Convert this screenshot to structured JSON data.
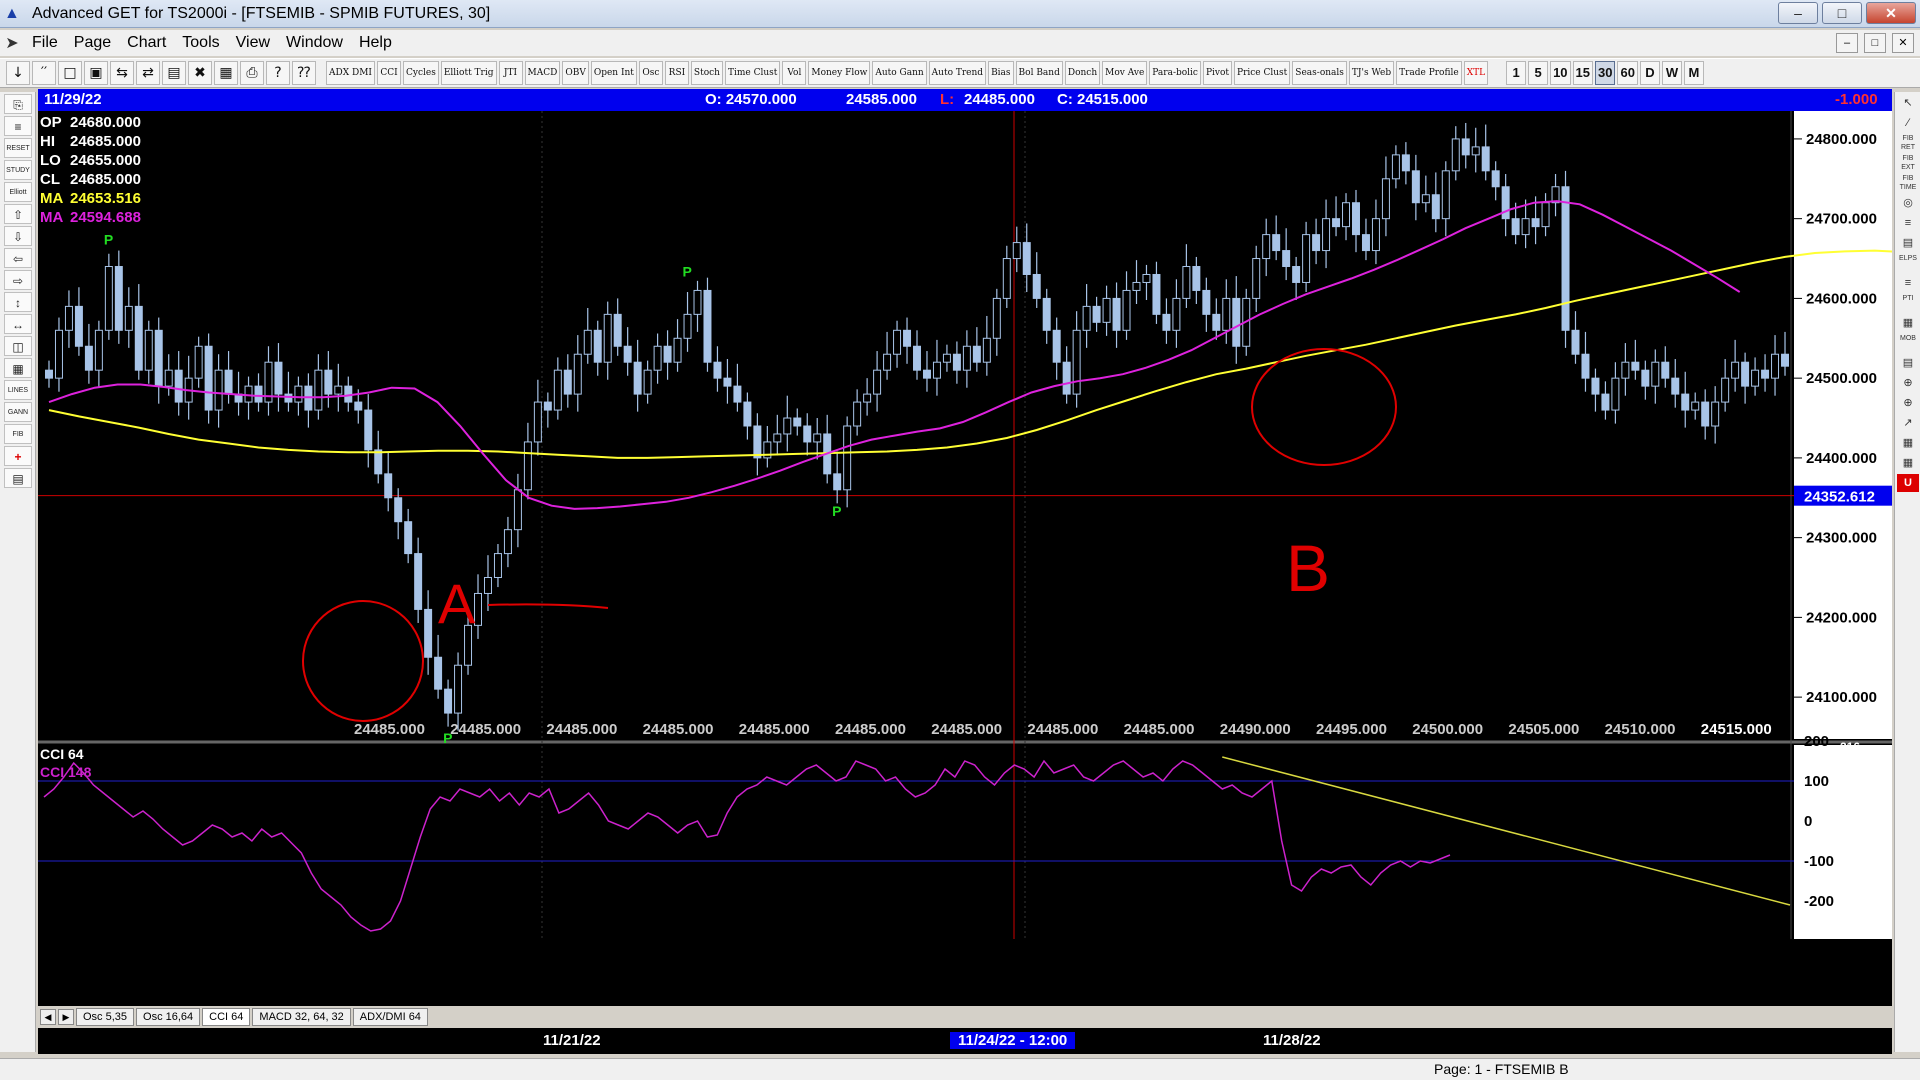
{
  "window": {
    "title": "Advanced GET for TS2000i - [FTSEMIB - SPMIB FUTURES, 30]",
    "minimize": "–",
    "maximize": "□",
    "close": "✕"
  },
  "menu": [
    "File",
    "Page",
    "Chart",
    "Tools",
    "View",
    "Window",
    "Help"
  ],
  "mdi_buttons": [
    "–",
    "□",
    "✕"
  ],
  "toolbar": {
    "file_icons": [
      "↓",
      "′′",
      "□",
      "▣",
      "⇆",
      "⇄",
      "▤",
      "✖",
      "▦",
      "⎙",
      "?",
      "⁇"
    ],
    "study_buttons": [
      "ADX DMI",
      "CCI",
      "Cycles",
      "Elliott Trig",
      "JTI",
      "MACD",
      "OBV",
      "Open Int",
      "Osc",
      "RSI",
      "Stoch",
      "Time Clust",
      "Vol",
      "Money Flow",
      "Auto Gann",
      "Auto Trend",
      "Bias",
      "Bol Band",
      "Donch",
      "Mov Ave",
      "Para-bolic",
      "Pivot",
      "Price Clust",
      "Seas-onals",
      "TJ's Web",
      "Trade Profile",
      "XTL"
    ],
    "periods": [
      "1",
      "5",
      "10",
      "15",
      "30",
      "60",
      "D",
      "W",
      "M"
    ],
    "active_period": "30"
  },
  "left_tools": [
    "⎘",
    "≡",
    "RESET",
    "STUDY",
    "Elliott",
    "⇧",
    "⇩",
    "⇦",
    "⇨",
    "↕",
    "↔",
    "◫",
    "▦",
    "LINES",
    "GANN",
    "FIB",
    "+",
    "▤"
  ],
  "right_tools": [
    "↖",
    "∕",
    "FIB RET",
    "FIB EXT",
    "FIB TIME",
    "◎",
    "≡",
    "▤",
    "ELPS",
    "≡",
    "PTI",
    "▦",
    "MOB",
    "▤",
    "⊕",
    "⊕",
    "↗",
    "▦",
    "▦",
    "U"
  ],
  "info_bar": {
    "date": "11/29/22",
    "open": "O: 24570.000",
    "high": "24585.000",
    "low_label": "L:",
    "low": "24485.000",
    "close": "C: 24515.000",
    "change": "-1.000"
  },
  "readout": {
    "op": {
      "label": "OP",
      "value": "24680.000"
    },
    "hi": {
      "label": "HI",
      "value": "24685.000"
    },
    "lo": {
      "label": "LO",
      "value": "24655.000"
    },
    "cl": {
      "label": "CL",
      "value": "24685.000"
    },
    "ma1": {
      "label": "MA",
      "value": "24653.516"
    },
    "ma2": {
      "label": "MA",
      "value": "24594.688"
    }
  },
  "cursor_price": "24352.612",
  "annotations": {
    "a": "A",
    "b": "B",
    "pivot": "P"
  },
  "colors": {
    "up": "#a8c4e8",
    "ma_fast": "#ffff33",
    "ma_slow": "#dd22dd",
    "cci": "#cc22cc",
    "trendline": "#d8d840",
    "marker": "#e00000",
    "pivot": "#22dd22",
    "info_bg": "#0000ee"
  },
  "chart_data": [
    {
      "type": "candlestick",
      "title": "FTSEMIB - SPMIB FUTURES, 30",
      "ylim": [
        24050,
        24830
      ],
      "y_ticks": [
        "24800.000",
        "24700.000",
        "24600.000",
        "24500.000",
        "24400.000",
        "24300.000",
        "24200.000",
        "24100.000"
      ],
      "x_price_labels": [
        "24485.000",
        "24485.000",
        "24485.000",
        "24485.000",
        "24485.000",
        "24485.000",
        "24485.000",
        "24485.000",
        "24485.000",
        "24490.000",
        "24495.000",
        "24500.000",
        "24505.000",
        "24510.000",
        "24515.000"
      ],
      "closes": [
        24500,
        24560,
        24590,
        24540,
        24510,
        24560,
        24640,
        24560,
        24590,
        24510,
        24560,
        24490,
        24510,
        24470,
        24500,
        24540,
        24460,
        24510,
        24480,
        24470,
        24490,
        24470,
        24520,
        24480,
        24470,
        24490,
        24460,
        24510,
        24480,
        24490,
        24470,
        24460,
        24410,
        24380,
        24350,
        24320,
        24280,
        24210,
        24150,
        24110,
        24080,
        24140,
        24190,
        24230,
        24250,
        24280,
        24310,
        24360,
        24420,
        24470,
        24460,
        24510,
        24480,
        24530,
        24560,
        24520,
        24580,
        24540,
        24520,
        24480,
        24510,
        24540,
        24520,
        24550,
        24580,
        24610,
        24520,
        24500,
        24490,
        24470,
        24440,
        24400,
        24420,
        24430,
        24450,
        24440,
        24420,
        24430,
        24380,
        24360,
        24440,
        24470,
        24480,
        24510,
        24530,
        24560,
        24540,
        24510,
        24500,
        24520,
        24530,
        24510,
        24540,
        24520,
        24550,
        24600,
        24650,
        24670,
        24630,
        24600,
        24560,
        24520,
        24480,
        24560,
        24590,
        24570,
        24600,
        24560,
        24610,
        24620,
        24630,
        24580,
        24560,
        24600,
        24640,
        24610,
        24580,
        24560,
        24600,
        24540,
        24600,
        24650,
        24680,
        24660,
        24640,
        24620,
        24680,
        24660,
        24700,
        24690,
        24720,
        24680,
        24660,
        24700,
        24750,
        24780,
        24760,
        24720,
        24730,
        24700,
        24760,
        24800,
        24780,
        24790,
        24760,
        24740,
        24700,
        24680,
        24700,
        24690,
        24720,
        24740,
        24560,
        24530,
        24500,
        24480,
        24460,
        24500,
        24520,
        24510,
        24490,
        24520,
        24500,
        24480,
        24460,
        24470,
        24440,
        24470,
        24500,
        24520,
        24490,
        24510,
        24500,
        24530,
        24515
      ],
      "ma_fast": [
        24460,
        24452,
        24445,
        24438,
        24430,
        24423,
        24418,
        24413,
        24410,
        24408,
        24407,
        24407,
        24408,
        24409,
        24409,
        24408,
        24406,
        24404,
        24402,
        24400,
        24400,
        24401,
        24402,
        24403,
        24404,
        24405,
        24406,
        24407,
        24408,
        24410,
        24413,
        24418,
        24425,
        24435,
        24447,
        24460,
        24472,
        24484,
        24495,
        24505,
        24512,
        24520,
        24528,
        24535,
        24542,
        24550,
        24558,
        24566,
        24573,
        24580,
        24588,
        24597,
        24605,
        24613,
        24621,
        24629,
        24637,
        24645,
        24652,
        24657,
        24659,
        24660,
        24658,
        24656,
        24652,
        24648,
        24640,
        24633
      ],
      "ma_fast_start": 0,
      "ma_fast_step": 3,
      "ma_slow": [
        24470,
        24480,
        24488,
        24492,
        24492,
        24489,
        24485,
        24482,
        24480,
        24478,
        24477,
        24476,
        24476,
        24478,
        24482,
        24488,
        24487,
        24470,
        24440,
        24405,
        24372,
        24350,
        24340,
        24336,
        24337,
        24339,
        24342,
        24345,
        24350,
        24357,
        24365,
        24374,
        24384,
        24395,
        24405,
        24415,
        24423,
        24428,
        24433,
        24437,
        24445,
        24457,
        24470,
        24482,
        24490,
        24496,
        24500,
        24505,
        24513,
        24523,
        24535,
        24550,
        24565,
        24580,
        24593,
        24605,
        24615,
        24625,
        24636,
        24648,
        24661,
        24674,
        24688,
        24700,
        24712,
        24720,
        24722,
        24718,
        24705,
        24690,
        24675,
        24660,
        24643,
        24626,
        24608
      ],
      "ma_slow_start": 0,
      "ma_slow_step": 2.29,
      "pivots": [
        {
          "bar": 6,
          "type": "high",
          "price": 24650
        },
        {
          "bar": 40,
          "type": "low",
          "price": 24070
        },
        {
          "bar": 64,
          "type": "high",
          "price": 24610
        },
        {
          "bar": 79,
          "type": "low",
          "price": 24355
        }
      ],
      "cursor_price": 24352.612
    },
    {
      "type": "line",
      "title": "CCI 64",
      "legend": "CCI 148",
      "ylim": [
        -280,
        210
      ],
      "y_ticks": [
        "200",
        "100",
        "0",
        "-100",
        "-200"
      ],
      "top_value": "216",
      "values": [
        60,
        80,
        110,
        145,
        120,
        90,
        70,
        50,
        30,
        10,
        25,
        5,
        -20,
        -40,
        -60,
        -50,
        -30,
        -10,
        -20,
        -40,
        -30,
        -50,
        -20,
        -40,
        -30,
        -55,
        -80,
        -130,
        -170,
        -190,
        -210,
        -240,
        -260,
        -275,
        -270,
        -250,
        -200,
        -120,
        -40,
        30,
        60,
        50,
        80,
        70,
        60,
        80,
        50,
        70,
        40,
        70,
        60,
        80,
        20,
        30,
        50,
        70,
        40,
        0,
        -10,
        -20,
        0,
        20,
        10,
        -10,
        -30,
        -10,
        0,
        -40,
        -35,
        20,
        60,
        80,
        90,
        110,
        100,
        90,
        110,
        130,
        140,
        120,
        100,
        110,
        150,
        140,
        130,
        100,
        110,
        80,
        60,
        70,
        90,
        130,
        110,
        150,
        140,
        110,
        90,
        120,
        140,
        130,
        110,
        150,
        120,
        130,
        140,
        110,
        100,
        120,
        140,
        150,
        130,
        110,
        120,
        100,
        130,
        150,
        140,
        120,
        100,
        80,
        90,
        70,
        60,
        80,
        100,
        -50,
        -160,
        -175,
        -140,
        -120,
        -130,
        -115,
        -110,
        -140,
        -160,
        -130,
        -110,
        -100,
        -115,
        -100,
        -105,
        -95,
        -85
      ],
      "trendline": {
        "from_index": 119,
        "from_value": 160,
        "to_value": -210
      }
    }
  ],
  "tabs": [
    "Osc 5,35",
    "Osc 16,64",
    "CCI 64",
    "MACD 32, 64, 32",
    "ADX/DMI 64"
  ],
  "active_tab": "CCI 64",
  "dates": {
    "d1": "11/21/22",
    "d2": "11/24/22 - 12:00",
    "d3": "11/28/22"
  },
  "status": "Page: 1 - FTSEMIB B"
}
